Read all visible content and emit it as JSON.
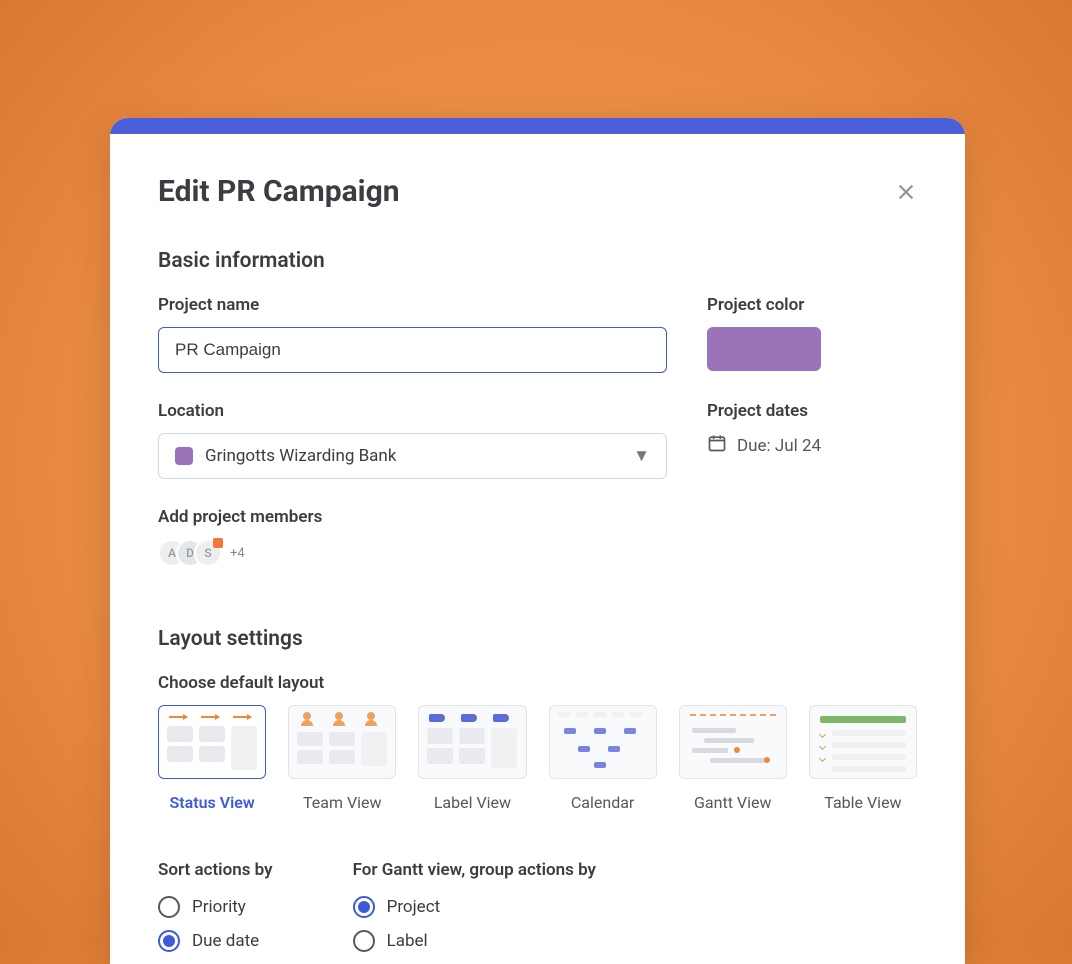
{
  "modal": {
    "title": "Edit PR Campaign",
    "sections": {
      "basic_info": "Basic information",
      "layout_settings": "Layout settings"
    },
    "labels": {
      "project_name": "Project name",
      "project_color": "Project color",
      "location": "Location",
      "project_dates": "Project dates",
      "add_members": "Add project members",
      "choose_layout": "Choose default layout",
      "sort_actions": "Sort actions by",
      "gantt_group": "For Gantt view, group actions by"
    },
    "fields": {
      "project_name_value": "PR Campaign",
      "project_color": "#9b73b8",
      "location_value": "Gringotts Wizarding Bank",
      "due_date": "Due: Jul 24"
    },
    "members": {
      "avatars": [
        "A",
        "D",
        "S"
      ],
      "more": "+4"
    },
    "layouts": [
      {
        "key": "status",
        "label": "Status View",
        "selected": true
      },
      {
        "key": "team",
        "label": "Team View",
        "selected": false
      },
      {
        "key": "label",
        "label": "Label View",
        "selected": false
      },
      {
        "key": "calendar",
        "label": "Calendar",
        "selected": false
      },
      {
        "key": "gantt",
        "label": "Gantt View",
        "selected": false
      },
      {
        "key": "table",
        "label": "Table View",
        "selected": false
      }
    ],
    "sort_options": [
      {
        "label": "Priority",
        "checked": false
      },
      {
        "label": "Due date",
        "checked": true
      }
    ],
    "gantt_group_options": [
      {
        "label": "Project",
        "checked": true
      },
      {
        "label": "Label",
        "checked": false
      }
    ]
  }
}
